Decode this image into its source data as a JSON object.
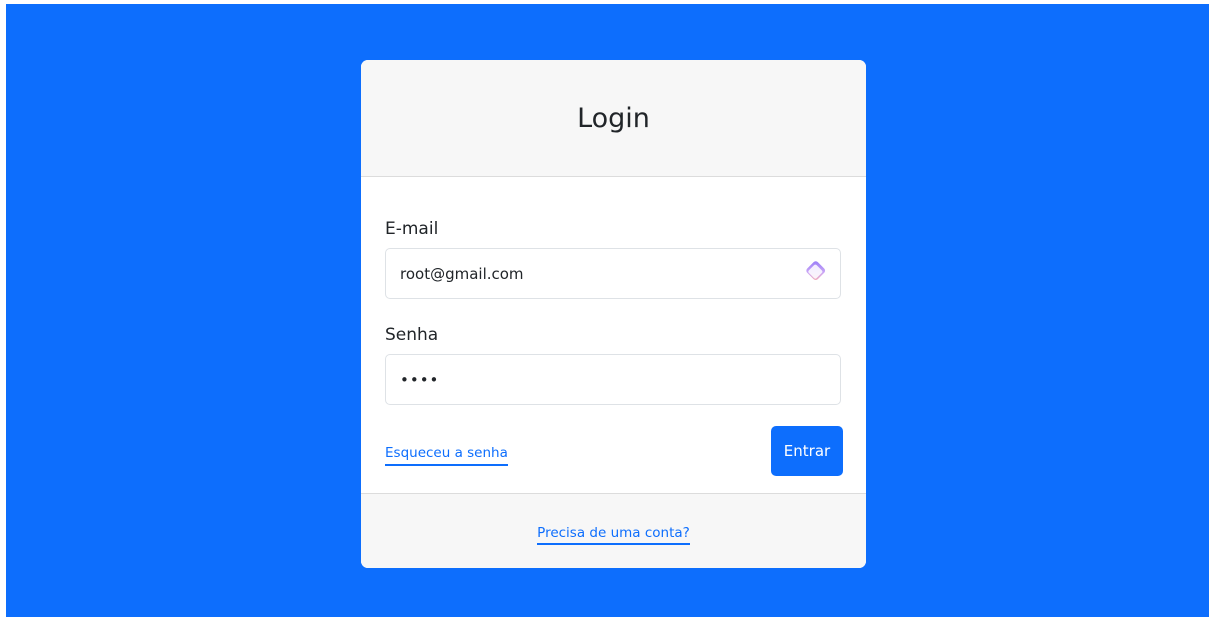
{
  "colors": {
    "background": "#0d6efd",
    "card": "#ffffff",
    "card_header": "#f7f7f7",
    "primary": "#0d6efd"
  },
  "login": {
    "title": "Login",
    "email_label": "E-mail",
    "email_value": "root@gmail.com",
    "email_icon": "password-manager-extension-icon",
    "password_label": "Senha",
    "password_value": "root",
    "forgot_link": "Esqueceu a senha",
    "submit_label": "Entrar"
  },
  "footer": {
    "register_link": "Precisa de uma conta?"
  }
}
